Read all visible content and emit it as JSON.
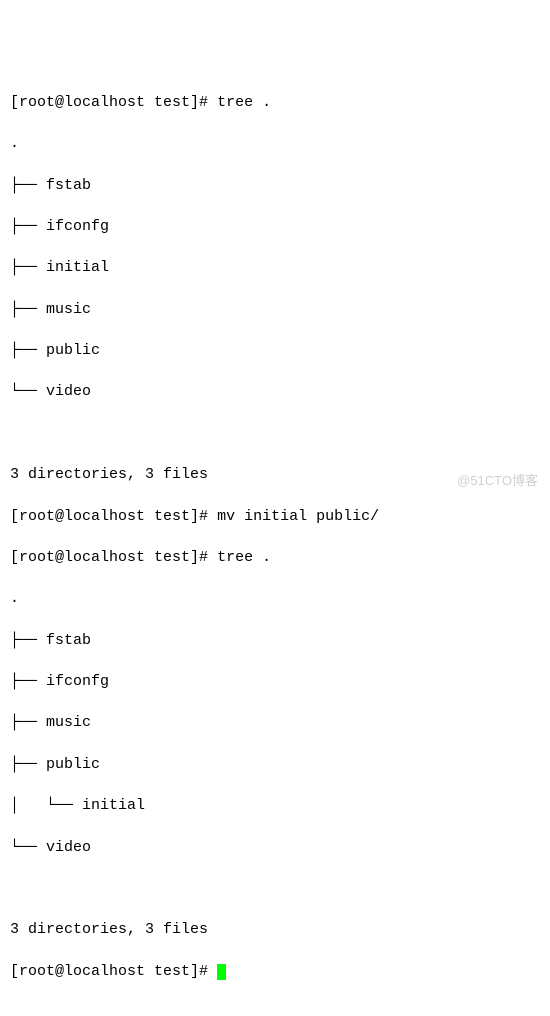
{
  "blocks": {
    "cmd1": {
      "prompt": "[root@localhost test]#",
      "command": "tree ."
    },
    "tree1": {
      "dot": ".",
      "l1": "├── fstab",
      "l2": "├── ifconfg",
      "l3": "├── initial",
      "l4": "├── music",
      "l5": "├── public",
      "l6": "└── video"
    },
    "summary1": "3 directories, 3 files",
    "cmd2": {
      "prompt": "[root@localhost test]#",
      "command": "mv initial public/"
    },
    "cmd3": {
      "prompt": "[root@localhost test]#",
      "command": "tree ."
    },
    "tree2": {
      "dot": ".",
      "l1": "├── fstab",
      "l2": "├── ifconfg",
      "l3": "├── music",
      "l4": "├── public",
      "l5": "│   └── initial",
      "l6": "└── video"
    },
    "summary2": "3 directories, 3 files",
    "cmd4": {
      "prompt": "[root@localhost test]#",
      "command": ""
    }
  },
  "watermark": "@51CTO博客"
}
